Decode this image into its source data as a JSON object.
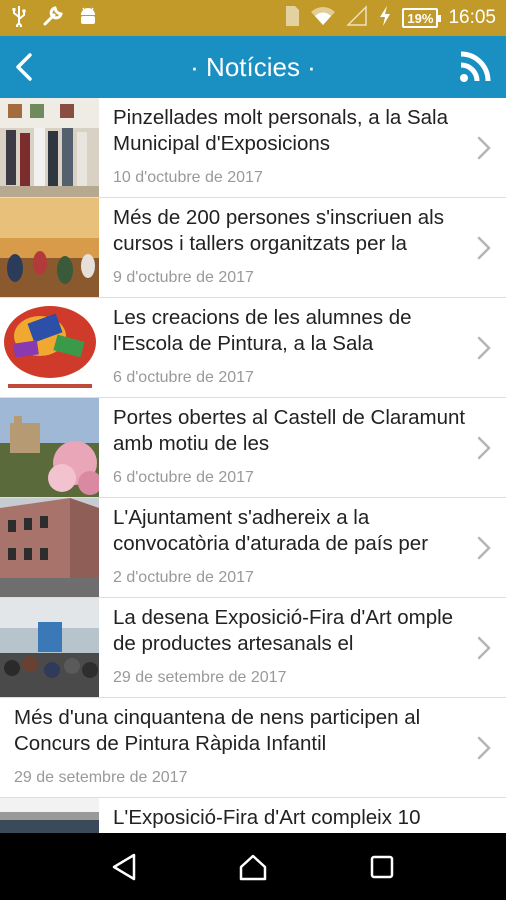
{
  "status_bar": {
    "battery": "19%",
    "time": "16:05"
  },
  "app_bar": {
    "title": "· Notícies ·"
  },
  "news": [
    {
      "title": "Pinzellades molt personals, a la Sala Municipal d'Exposicions",
      "date": "10 d'octubre de 2017"
    },
    {
      "title": "Més de 200 persones s'inscriuen als cursos i tallers organitzats per la",
      "date": "9 d'octubre de 2017"
    },
    {
      "title": "Les creacions de les alumnes de l'Escola de Pintura, a la Sala",
      "date": "6 d'octubre de 2017"
    },
    {
      "title": "Portes obertes al Castell de Claramunt amb motiu de les",
      "date": "6 d'octubre de 2017"
    },
    {
      "title": "L'Ajuntament s'adhereix a la convocatòria d'aturada de país per",
      "date": "2 d'octubre de 2017"
    },
    {
      "title": "La desena Exposició-Fira d'Art omple de productes artesanals el",
      "date": "29 de setembre de 2017"
    },
    {
      "title": "Més d'una cinquantena de nens participen al Concurs de Pintura Ràpida Infantil",
      "date": "29 de setembre de 2017"
    },
    {
      "title": "L'Exposició-Fira d'Art compleix 10",
      "date": ""
    }
  ]
}
